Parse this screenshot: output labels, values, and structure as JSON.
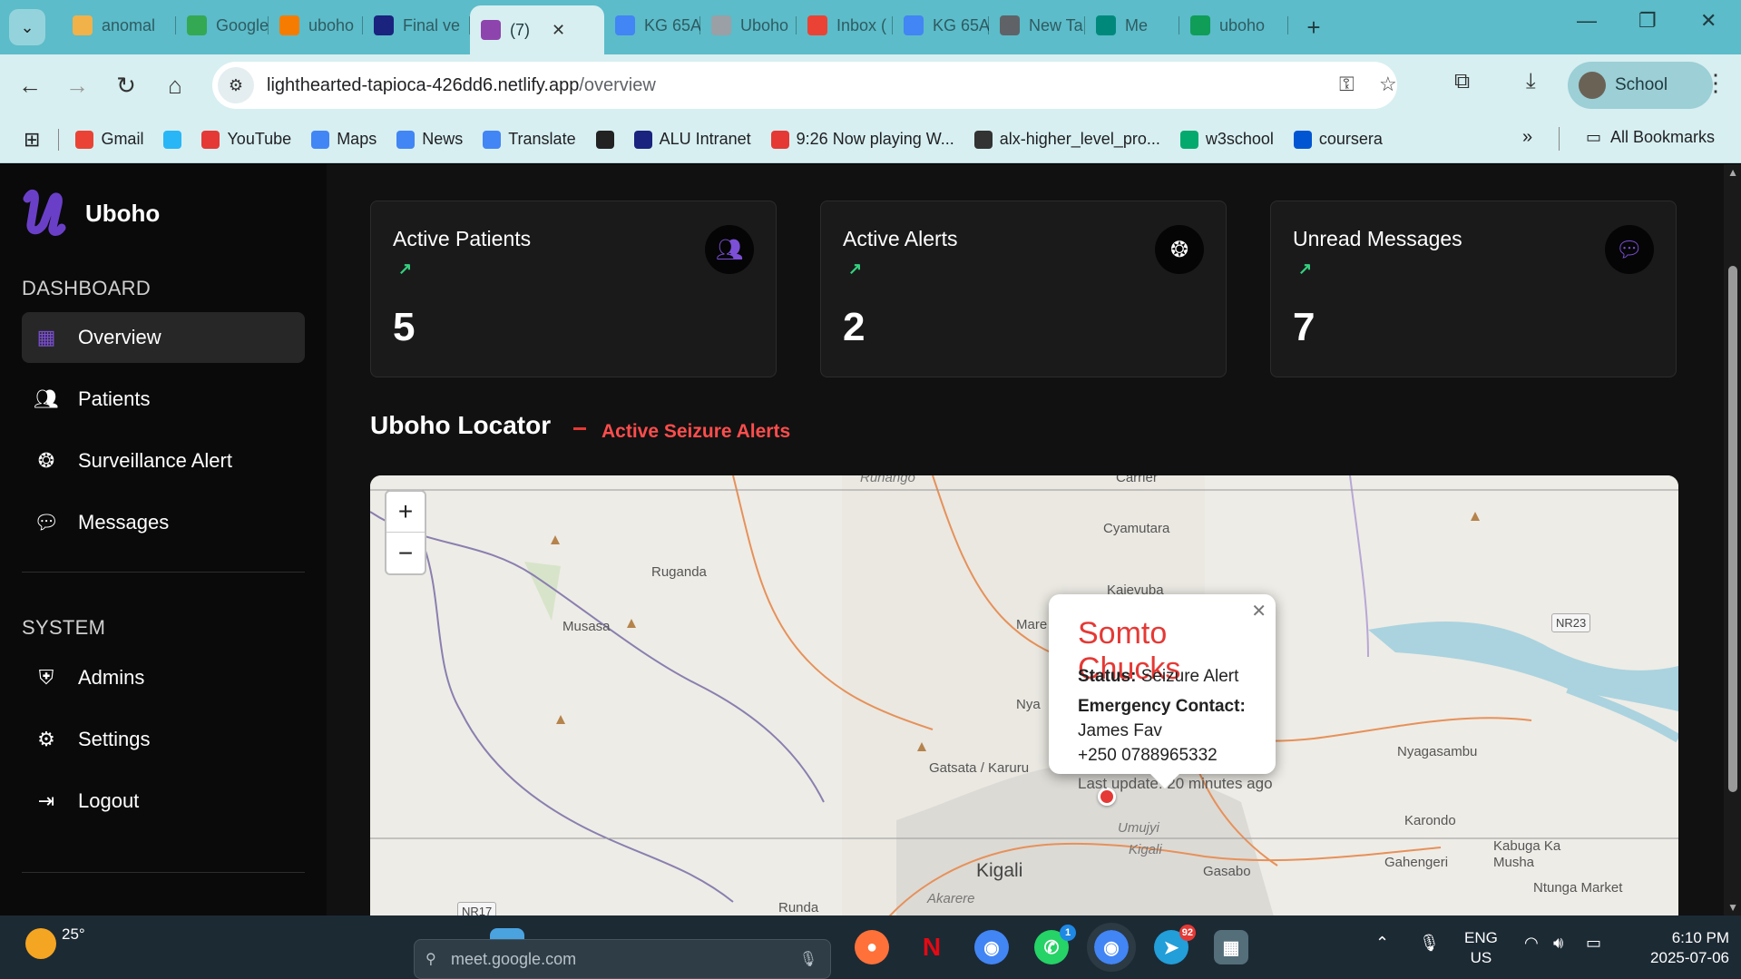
{
  "browser": {
    "tabs": [
      {
        "label": "anomal",
        "icon": "folder-icon",
        "color": "#f1b24a"
      },
      {
        "label": "Google",
        "icon": "google-sheets-icon",
        "color": "#34a853"
      },
      {
        "label": "uboho",
        "icon": "firebase-icon",
        "color": "#f57c00"
      },
      {
        "label": "Final ve",
        "icon": "alu-icon",
        "color": "#1a237e"
      },
      {
        "label": "(7)",
        "icon": "vite-icon",
        "color": "#8e44ad",
        "active": true
      },
      {
        "label": "KG 65A",
        "icon": "maps-icon",
        "color": "#4285f4"
      },
      {
        "label": "Uboho",
        "icon": "globe-icon",
        "color": "#9aa0a6"
      },
      {
        "label": "Inbox (",
        "icon": "gmail-icon",
        "color": "#ea4335"
      },
      {
        "label": "KG 65A",
        "icon": "maps-icon",
        "color": "#4285f4"
      },
      {
        "label": "New Ta",
        "icon": "chrome-icon",
        "color": "#5f6368"
      },
      {
        "label": "Me",
        "icon": "meet-icon",
        "color": "#00897b"
      },
      {
        "label": "uboho",
        "icon": "drive-icon",
        "color": "#0f9d58"
      }
    ],
    "url_host": "lighthearted-tapioca-426dd6.netlify.app",
    "url_path": "/overview",
    "profile_label": "School",
    "bookmarks": [
      {
        "label": "Gmail",
        "icon": "gmail-icon",
        "color": "#ea4335"
      },
      {
        "label": "",
        "icon": "cube-icon",
        "color": "#29b6f6"
      },
      {
        "label": "YouTube",
        "icon": "youtube-icon",
        "color": "#e53935"
      },
      {
        "label": "Maps",
        "icon": "maps-icon",
        "color": "#4285f4"
      },
      {
        "label": "News",
        "icon": "news-icon",
        "color": "#4285f4"
      },
      {
        "label": "Translate",
        "icon": "translate-icon",
        "color": "#4285f4"
      },
      {
        "label": "",
        "icon": "globe-dark-icon",
        "color": "#222"
      },
      {
        "label": "ALU Intranet",
        "icon": "alu-icon",
        "color": "#1a237e"
      },
      {
        "label": "9:26 Now playing W...",
        "icon": "youtube-icon",
        "color": "#e53935"
      },
      {
        "label": "alx-higher_level_pro...",
        "icon": "github-icon",
        "color": "#333"
      },
      {
        "label": "w3school",
        "icon": "w3school-icon",
        "color": "#04aa6d"
      },
      {
        "label": "coursera",
        "icon": "coursera-icon",
        "color": "#0056d2"
      }
    ],
    "all_bookmarks_label": "All Bookmarks"
  },
  "sidebar": {
    "brand": "Uboho",
    "dashboard_label": "DASHBOARD",
    "dashboard_items": [
      {
        "label": "Overview",
        "icon": "grid-icon",
        "active": true
      },
      {
        "label": "Patients",
        "icon": "users-icon"
      },
      {
        "label": "Surveillance Alert",
        "icon": "aperture-icon"
      },
      {
        "label": "Messages",
        "icon": "chat-icon"
      }
    ],
    "system_label": "SYSTEM",
    "system_items": [
      {
        "label": "Admins",
        "icon": "shield-user-icon"
      },
      {
        "label": "Settings",
        "icon": "gear-icon"
      },
      {
        "label": "Logout",
        "icon": "logout-icon"
      }
    ]
  },
  "cards": [
    {
      "title": "Active Patients",
      "value": "5",
      "icon": "users-icon",
      "icon_color": "#7b4fd6"
    },
    {
      "title": "Active Alerts",
      "value": "2",
      "icon": "aperture-icon",
      "icon_color": "#ffffff"
    },
    {
      "title": "Unread Messages",
      "value": "7",
      "icon": "chat-icon",
      "icon_color": "#7b4fd6"
    }
  ],
  "locator": {
    "title": "Uboho Locator",
    "subtitle": "Active Seizure Alerts",
    "zoom_in": "+",
    "zoom_out": "−",
    "places": [
      "Carrier",
      "Cyamutara",
      "Ruganda",
      "Musasa",
      "Mare",
      "Nya",
      "Gatsata / Karuru",
      "Umujyi",
      "Kigali",
      "Kigali",
      "Gasabo",
      "Karondo",
      "Gahengeri",
      "Kabuga Ka Musha",
      "Ntunga Market",
      "Nyagasambu",
      "Akarere",
      "Runda",
      "Ruhango",
      "Kajevuba"
    ],
    "road_labels": [
      "NR23",
      "NR17"
    ],
    "popup": {
      "name": "Somto Chucks",
      "status_label": "Status:",
      "status": "Seizure Alert",
      "contact_label": "Emergency Contact:",
      "contact_name": "James Fav",
      "contact_phone": "+250 0788965332",
      "last_update": "Last update: 20 minutes ago"
    }
  },
  "taskbar": {
    "temperature": "25°",
    "search_text": "meet.google.com",
    "whatsapp_badge": "1",
    "telegram_badge": "92",
    "lang_line1": "ENG",
    "lang_line2": "US",
    "time": "6:10 PM",
    "date": "2025-07-06"
  },
  "colors": {
    "accent_purple": "#7b4fd6",
    "alert_red": "#e53935",
    "trend_green": "#35d07f",
    "chrome_teal": "#5cbcc9"
  }
}
